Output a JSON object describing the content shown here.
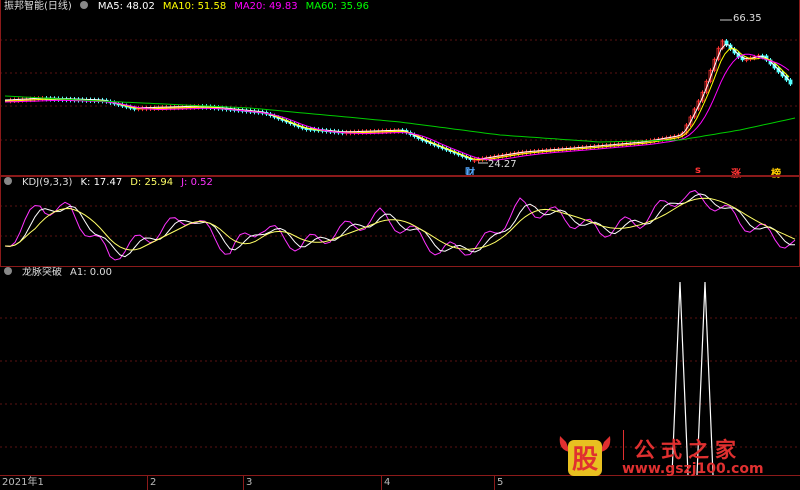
{
  "main": {
    "title": "振邦智能(日线)",
    "ma": [
      {
        "label": "MA5: 48.02",
        "color": "#ffffff"
      },
      {
        "label": "MA10: 51.58",
        "color": "#ffff00"
      },
      {
        "label": "MA20: 49.83",
        "color": "#ff00ff"
      },
      {
        "label": "MA60: 35.96",
        "color": "#00ff00"
      }
    ],
    "high_label": "66.35",
    "low_label": "24.27",
    "event_marks": [
      {
        "text": "财",
        "color": "#55aaff"
      },
      {
        "text": "s",
        "color": "#ff3333"
      },
      {
        "text": "涨",
        "color": "#ff3333"
      },
      {
        "text": "榜",
        "color": "#ffcc00"
      }
    ]
  },
  "kdj": {
    "title": "KDJ(9,3,3)",
    "k": "K: 17.47",
    "d": "D: 25.94",
    "j": "J: 0.52",
    "k_color": "#ffffff",
    "d_color": "#ffff66",
    "j_color": "#ff33ff"
  },
  "indicator": {
    "title": "龙脉突破",
    "a1": "A1: 0.00"
  },
  "xaxis": {
    "ticks": [
      "2021年1",
      "2",
      "3",
      "4",
      "5"
    ]
  },
  "watermark": {
    "logo_char": "股",
    "title": "公式之家",
    "url": "www.gszj100.com"
  },
  "colors": {
    "up": "#ff3333",
    "down": "#55ffff",
    "border": "#8b1a1a"
  }
}
